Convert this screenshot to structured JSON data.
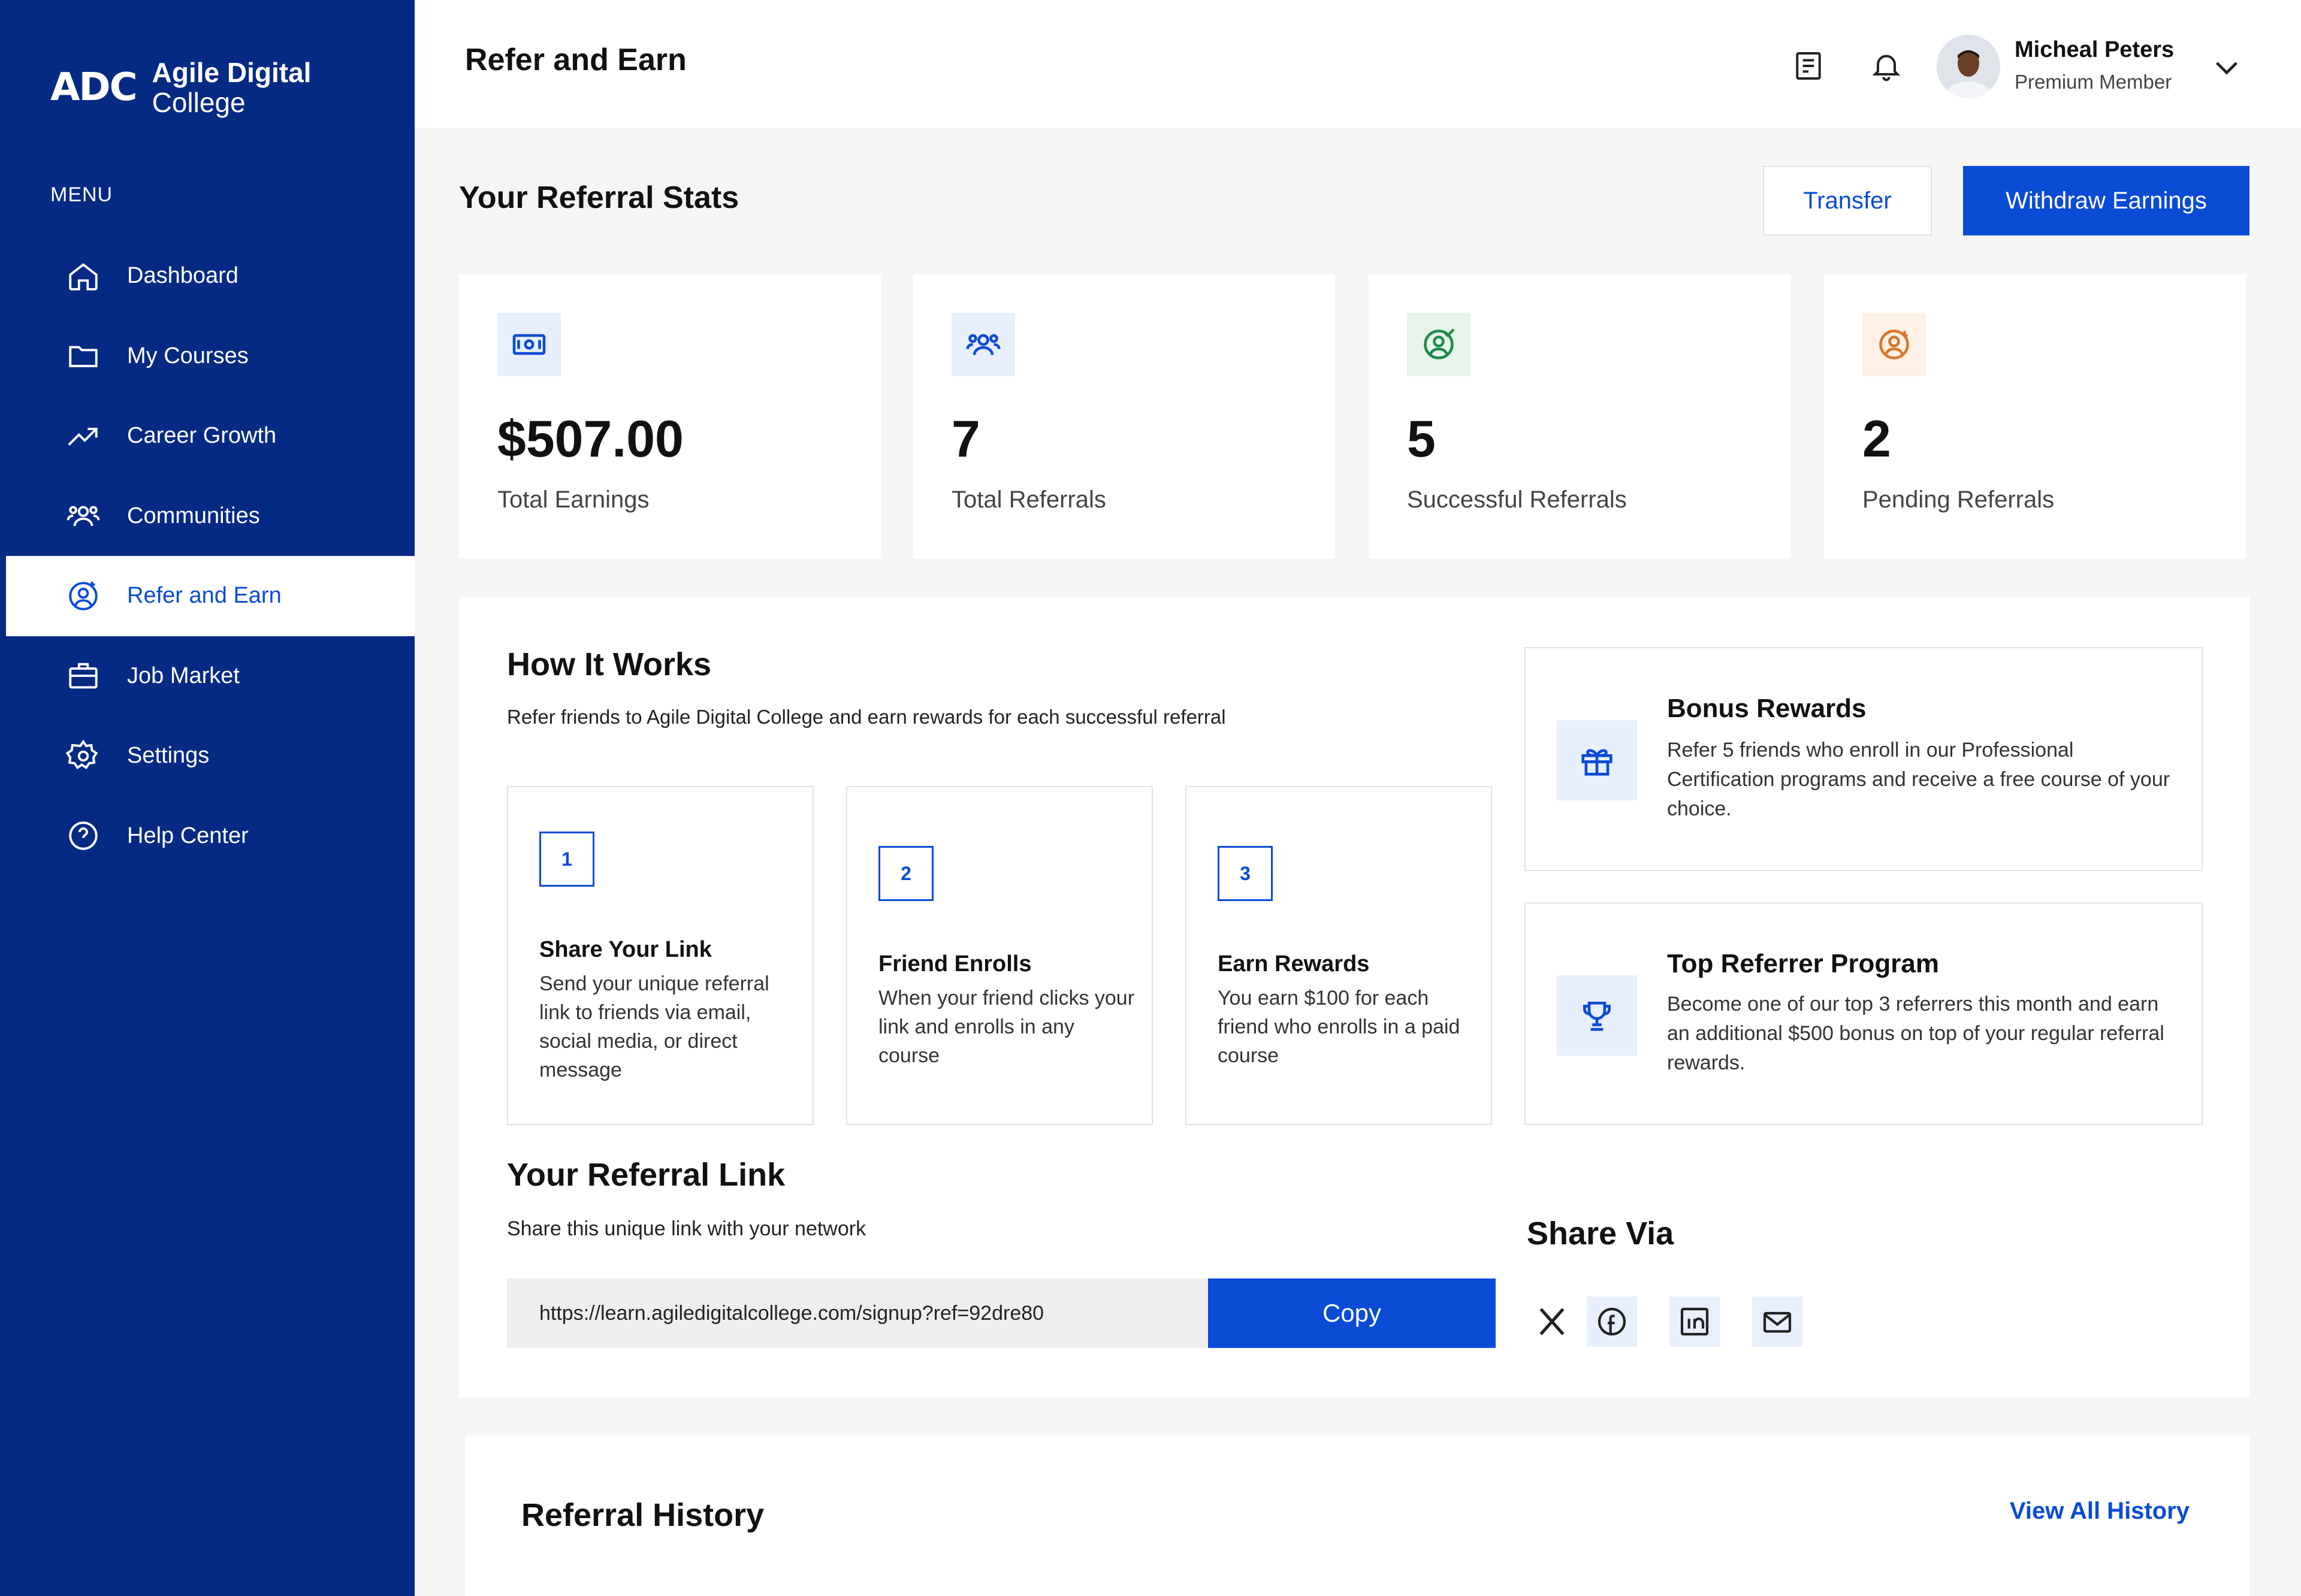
{
  "brand": {
    "mark": "ADC",
    "name_line1": "Agile Digital",
    "name_line2": "College"
  },
  "sidebar": {
    "menu_label": "MENU",
    "items": [
      {
        "label": "Dashboard",
        "icon": "home-icon"
      },
      {
        "label": "My Courses",
        "icon": "folder-icon"
      },
      {
        "label": "Career Growth",
        "icon": "trend-up-icon"
      },
      {
        "label": "Communities",
        "icon": "users-icon"
      },
      {
        "label": "Refer and Earn",
        "icon": "user-plus-icon",
        "active": true
      },
      {
        "label": "Job Market",
        "icon": "briefcase-icon"
      },
      {
        "label": "Settings",
        "icon": "gear-icon"
      },
      {
        "label": "Help Center",
        "icon": "question-icon"
      }
    ]
  },
  "header": {
    "title": "Refer and Earn",
    "user_name": "Micheal Peters",
    "user_role": "Premium Member"
  },
  "stats": {
    "title": "Your Referral Stats",
    "transfer_label": "Transfer",
    "withdraw_label": "Withdraw Earnings",
    "cards": [
      {
        "value": "$507.00",
        "label": "Total Earnings",
        "icon": "cash-icon",
        "color": "#0a4bd6",
        "bg": "#e7eefc"
      },
      {
        "value": "7",
        "label": "Total Referrals",
        "icon": "users-icon",
        "color": "#0a4bd6",
        "bg": "#e7eefc"
      },
      {
        "value": "5",
        "label": "Successful Referrals",
        "icon": "user-check-icon",
        "color": "#1c8a4a",
        "bg": "#e6f4ea"
      },
      {
        "value": "2",
        "label": "Pending Referrals",
        "icon": "user-clock-icon",
        "color": "#d9762b",
        "bg": "#fdf0e4"
      }
    ]
  },
  "how_it_works": {
    "title": "How It Works",
    "subtitle": "Refer friends to Agile Digital College and earn rewards for each successful referral",
    "steps": [
      {
        "num": "1",
        "title": "Share Your Link",
        "desc": "Send your unique referral link to friends via email, social media, or direct message"
      },
      {
        "num": "2",
        "title": "Friend Enrolls",
        "desc": "When your friend clicks your link and enrolls in any course"
      },
      {
        "num": "3",
        "title": "Earn Rewards",
        "desc": "You earn $100 for each friend who enrolls in a paid course"
      }
    ],
    "rewards": [
      {
        "title": "Bonus Rewards",
        "desc": "Refer 5 friends who enroll in our Professional Certification programs and receive a free course of your choice.",
        "icon": "gift-icon"
      },
      {
        "title": "Top Referrer Program",
        "desc": "Become one of our top 3 referrers this month and earn an additional $500 bonus on top of your regular referral rewards.",
        "icon": "trophy-icon"
      }
    ]
  },
  "referral_link": {
    "title": "Your Referral Link",
    "subtitle": "Share this unique link with your network",
    "url": "https://learn.agiledigitalcollege.com/signup?ref=92dre80",
    "copy_label": "Copy",
    "share_title": "Share Via",
    "share_icons": [
      "x-icon",
      "facebook-icon",
      "linkedin-icon",
      "mail-icon"
    ]
  },
  "history": {
    "title": "Referral History",
    "view_all": "View All History"
  },
  "colors": {
    "brand": "#052a84",
    "accent": "#0a4bd6"
  }
}
